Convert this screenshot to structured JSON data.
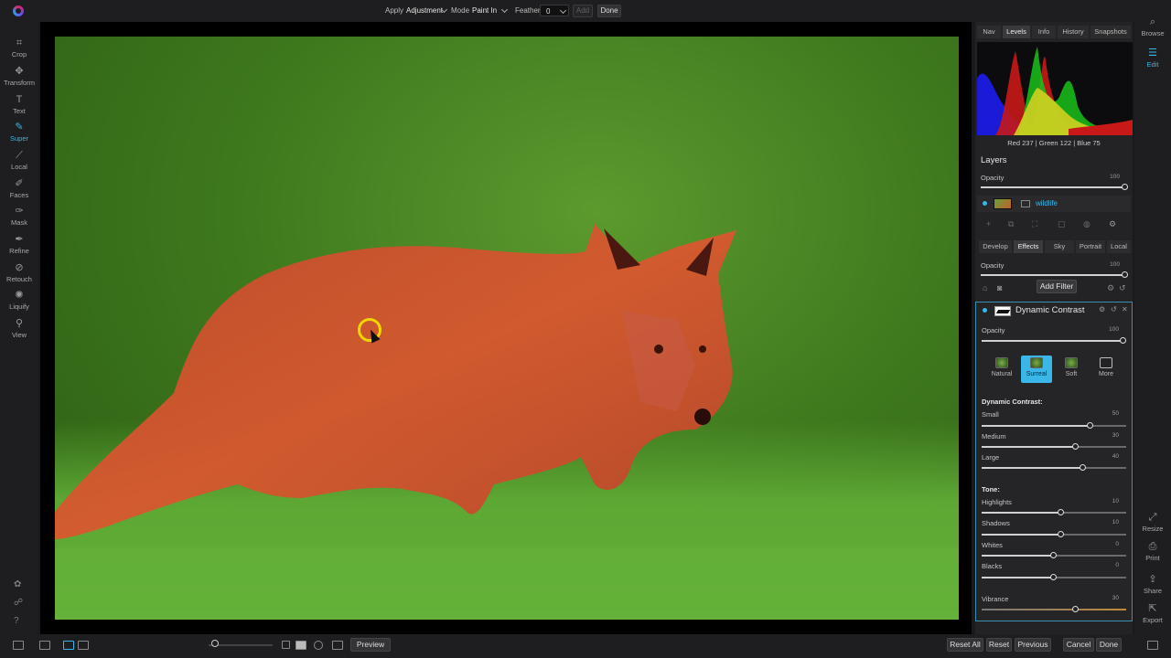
{
  "toolbar": {
    "apply_label": "Apply",
    "apply_value": "Adjustment",
    "mode_label": "Mode",
    "mode_value": "Paint In",
    "feather_label": "Feather",
    "feather_value": "0",
    "add_label": "Add",
    "done_label": "Done"
  },
  "left_tools": [
    {
      "label": "Crop",
      "icon": "crop-icon"
    },
    {
      "label": "Transform",
      "icon": "transform-icon"
    },
    {
      "label": "Text",
      "icon": "text-icon"
    },
    {
      "label": "Super",
      "icon": "super-icon",
      "active": true
    },
    {
      "label": "Local",
      "icon": "local-icon"
    },
    {
      "label": "Faces",
      "icon": "faces-icon"
    },
    {
      "label": "Mask",
      "icon": "mask-icon"
    },
    {
      "label": "Refine",
      "icon": "refine-icon"
    },
    {
      "label": "Retouch",
      "icon": "retouch-icon"
    },
    {
      "label": "Liquify",
      "icon": "liquify-icon"
    },
    {
      "label": "View",
      "icon": "view-icon"
    }
  ],
  "right_tabs": [
    "Nav",
    "Levels",
    "Info",
    "History",
    "Snapshots"
  ],
  "active_right_tab": "Levels",
  "histogram": {
    "readout": "Red 237 | Green 122 | Blue 75"
  },
  "layers": {
    "title": "Layers",
    "opacity_label": "Opacity",
    "opacity_value": "100",
    "opacity_level": 100,
    "layer_name": "wildlife"
  },
  "module_tabs": [
    "Develop",
    "Effects",
    "Sky",
    "Portrait",
    "Local"
  ],
  "active_module_tab": "Effects",
  "effects": {
    "opacity_label": "Opacity",
    "opacity_value": "100",
    "opacity_level": 100,
    "add_filter_label": "Add Filter"
  },
  "dynamic_contrast": {
    "title": "Dynamic Contrast",
    "opacity_label": "Opacity",
    "opacity_value": "100",
    "presets": [
      "Natural",
      "Surreal",
      "Soft",
      "More"
    ],
    "active_preset": "Surreal",
    "section_contrast": "Dynamic Contrast:",
    "section_tone": "Tone:",
    "sliders": [
      {
        "label": "Small",
        "value": "50",
        "level": 0.75
      },
      {
        "label": "Medium",
        "value": "30",
        "level": 0.65
      },
      {
        "label": "Large",
        "value": "40",
        "level": 0.7
      },
      {
        "label": "Highlights",
        "value": "10",
        "level": 0.55
      },
      {
        "label": "Shadows",
        "value": "10",
        "level": 0.55
      },
      {
        "label": "Whites",
        "value": "0",
        "level": 0.5
      },
      {
        "label": "Blacks",
        "value": "0",
        "level": 0.5
      },
      {
        "label": "Vibrance",
        "value": "30",
        "level": 0.65
      }
    ]
  },
  "far_right": [
    {
      "label": "Browse",
      "icon": "browse-icon"
    },
    {
      "label": "Edit",
      "icon": "edit-icon",
      "active": true
    },
    {
      "label": "Resize",
      "icon": "resize-icon"
    },
    {
      "label": "Print",
      "icon": "print-icon"
    },
    {
      "label": "Share",
      "icon": "share-icon"
    },
    {
      "label": "Export",
      "icon": "export-icon"
    }
  ],
  "bottom": {
    "preview_label": "Preview",
    "reset_all_label": "Reset All",
    "reset_label": "Reset",
    "previous_label": "Previous",
    "cancel_label": "Cancel",
    "done_label": "Done"
  },
  "colors": {
    "accent": "#3ab6e8",
    "mask_overlay": "#d8402a",
    "brush_ring": "#f0d500"
  }
}
